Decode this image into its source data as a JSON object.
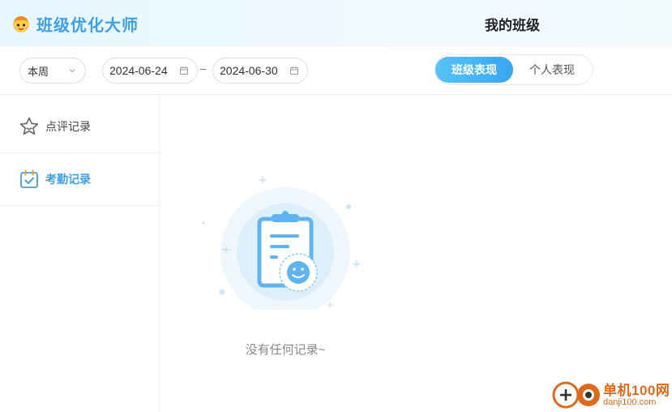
{
  "app": {
    "name": "班级优化大师",
    "page_title": "我的班级",
    "accent_color": "#3d9fe8"
  },
  "filters": {
    "period_select": "本周",
    "start_date": "2024-06-24",
    "separator": "–",
    "end_date": "2024-06-30",
    "view_tabs": [
      {
        "label": "班级表现",
        "active": true
      },
      {
        "label": "个人表现",
        "active": false
      }
    ]
  },
  "sidebar": {
    "items": [
      {
        "label": "点评记录",
        "icon": "star-icon",
        "active": false
      },
      {
        "label": "考勤记录",
        "icon": "calendar-check-icon",
        "active": true
      }
    ]
  },
  "empty_state": {
    "icon": "clipboard-smile-icon",
    "message": "没有任何记录~"
  },
  "watermark": {
    "title": "单机100网",
    "url": "danji100.com"
  }
}
